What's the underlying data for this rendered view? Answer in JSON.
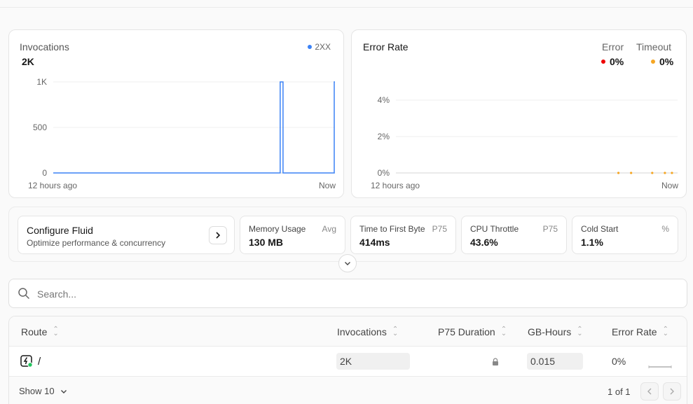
{
  "invocations": {
    "title": "Invocations",
    "total": "2K",
    "legend": "2XX",
    "y_ticks": [
      "1K",
      "500",
      "0"
    ],
    "x_start": "12 hours ago",
    "x_end": "Now",
    "colors": {
      "series": "#3b82f6"
    }
  },
  "error_rate": {
    "title": "Error Rate",
    "error_label": "Error",
    "error_value": "0%",
    "timeout_label": "Timeout",
    "timeout_value": "0%",
    "y_ticks": [
      "4%",
      "2%",
      "0%"
    ],
    "x_start": "12 hours ago",
    "x_end": "Now",
    "colors": {
      "error": "#e5484d",
      "timeout": "#f5a623"
    }
  },
  "chart_data": [
    {
      "type": "line",
      "title": "Invocations",
      "series": [
        {
          "name": "2XX",
          "values": [
            0,
            0,
            0,
            0,
            0,
            0,
            0,
            0,
            0,
            0,
            0,
            0,
            0,
            0,
            0,
            0,
            0,
            0,
            0,
            0,
            0,
            0,
            0,
            0,
            0,
            0,
            0,
            0,
            0,
            0,
            0,
            0,
            0,
            0,
            0,
            0,
            0,
            0,
            0,
            0,
            0,
            0,
            0,
            0,
            0,
            0,
            0,
            0,
            0,
            0,
            0,
            0,
            0,
            0,
            0,
            0,
            0,
            0,
            0,
            0,
            0,
            0,
            0,
            0,
            0,
            0,
            0,
            0,
            0,
            0,
            0,
            0,
            0,
            0,
            0,
            0,
            0,
            0,
            0,
            0,
            1000,
            0,
            0,
            0,
            0,
            0,
            0,
            0,
            0,
            0,
            0,
            0,
            0,
            0,
            0,
            0,
            0,
            0,
            0,
            1000
          ]
        }
      ],
      "ylim": [
        0,
        1000
      ],
      "xlabel": "",
      "ylabel": ""
    },
    {
      "type": "scatter",
      "title": "Error Rate",
      "series": [
        {
          "name": "Error",
          "values": []
        },
        {
          "name": "Timeout",
          "values": [
            0,
            0,
            0,
            0,
            0
          ]
        }
      ],
      "ylim": [
        0,
        4
      ]
    }
  ],
  "configure": {
    "title": "Configure Fluid",
    "subtitle": "Optimize performance & concurrency"
  },
  "metrics": [
    {
      "label": "Memory Usage",
      "qualifier": "Avg",
      "value": "130 MB"
    },
    {
      "label": "Time to First Byte",
      "qualifier": "P75",
      "value": "414ms"
    },
    {
      "label": "CPU Throttle",
      "qualifier": "P75",
      "value": "43.6%"
    },
    {
      "label": "Cold Start",
      "qualifier": "%",
      "value": "1.1%"
    }
  ],
  "search": {
    "placeholder": "Search..."
  },
  "table": {
    "columns": [
      "Route",
      "Invocations",
      "P75 Duration",
      "GB-Hours",
      "Error Rate"
    ],
    "rows": [
      {
        "route": "/",
        "invocations": "2K",
        "gb_hours": "0.015",
        "error_rate": "0%"
      }
    ]
  },
  "footer": {
    "show": "Show 10",
    "pages": "1 of 1"
  }
}
